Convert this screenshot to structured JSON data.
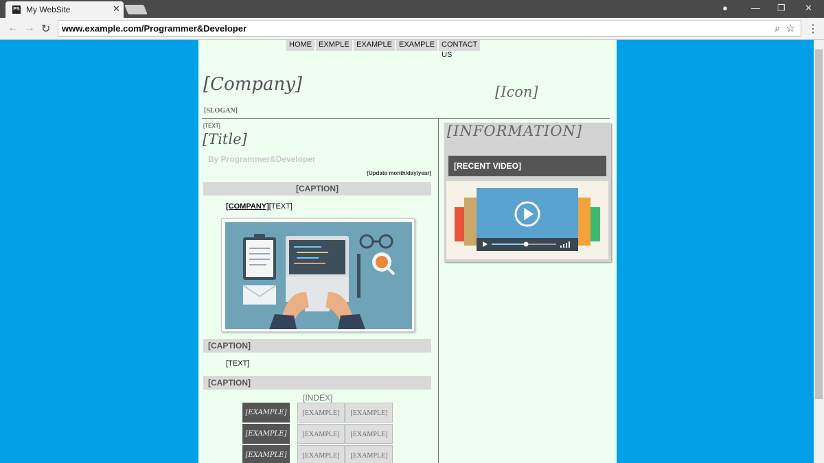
{
  "browser": {
    "tab_title": "My WebSite",
    "tab_close": "✕",
    "favicon": "PS",
    "url": "www.example.com/Programmer&Developer",
    "controls": {
      "minimize": "—",
      "maximize": "❐",
      "close": "✕"
    }
  },
  "nav": {
    "items": [
      "HOME",
      "EXMPLE",
      "EXAMPLE",
      "EXAMPLE",
      "CONTACT US"
    ]
  },
  "header": {
    "company": "[Company]",
    "icon": "[Icon]",
    "slogan": "[SLOGAN]"
  },
  "article": {
    "text_small": "[TEXT]",
    "title": "[Title]",
    "byline": "By Programmer&Developer",
    "update": "[Update month/day/year]",
    "caption1": "[CAPTION]",
    "company_link": "[COMPANY]",
    "company_text": "[TEXT]",
    "caption2": "[CAPTION]",
    "text2": "[TEXT]",
    "caption3": "[CAPTION]",
    "index_label": "[INDEX]",
    "table": [
      [
        "[EXAMPLE]",
        "[EXAMPLE]",
        "[EXAMPLE]"
      ],
      [
        "[EXAMPLE]",
        "[EXAMPLE]",
        "[EXAMPLE]"
      ],
      [
        "[EXAMPLE]",
        "[EXAMPLE]",
        "[EXAMPLE]"
      ]
    ]
  },
  "sidebar": {
    "info_title": "[INFORMATION]",
    "recent_video": "[RECENT VIDEO]"
  }
}
